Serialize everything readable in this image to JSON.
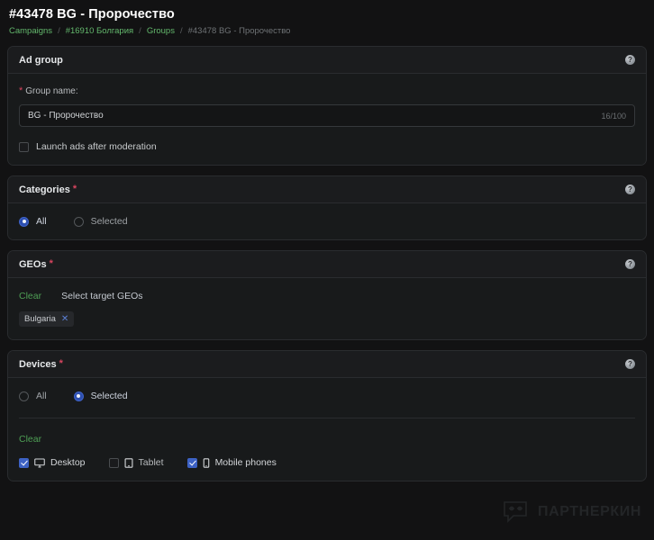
{
  "header": {
    "title": "#43478 BG - Пророчество",
    "breadcrumb": [
      {
        "label": "Campaigns",
        "type": "link"
      },
      {
        "label": "/",
        "type": "sep"
      },
      {
        "label": "#16910 Болгария",
        "type": "link"
      },
      {
        "label": "/",
        "type": "sep"
      },
      {
        "label": "Groups",
        "type": "link"
      },
      {
        "label": "/",
        "type": "sep"
      },
      {
        "label": "#43478 BG - Пророчество",
        "type": "current"
      }
    ]
  },
  "ad_group": {
    "card_title": "Ad group",
    "help_icon": "question-mark-icon",
    "field_label": "Group name:",
    "required_mark": "*",
    "input_value": "BG - Пророчество",
    "input_counter": "16/100",
    "checkbox_label": "Launch ads after moderation",
    "checkbox_checked": false
  },
  "categories": {
    "card_title": "Categories",
    "required_mark": "*",
    "help_icon": "question-mark-icon",
    "options": [
      {
        "label": "All",
        "selected": true
      },
      {
        "label": "Selected",
        "selected": false
      }
    ]
  },
  "geos": {
    "card_title": "GEOs",
    "required_mark": "*",
    "help_icon": "question-mark-icon",
    "clear_label": "Clear",
    "select_label": "Select target GEOs",
    "chips": [
      {
        "label": "Bulgaria",
        "close_icon": "close-icon"
      }
    ]
  },
  "devices": {
    "card_title": "Devices",
    "required_mark": "*",
    "help_icon": "question-mark-icon",
    "options": [
      {
        "label": "All",
        "selected": false
      },
      {
        "label": "Selected",
        "selected": true
      }
    ],
    "clear_label": "Clear",
    "items": [
      {
        "label": "Desktop",
        "icon": "desktop-icon",
        "checked": true
      },
      {
        "label": "Tablet",
        "icon": "tablet-icon",
        "checked": false
      },
      {
        "label": "Mobile phones",
        "icon": "mobile-phone-icon",
        "checked": true
      }
    ]
  },
  "watermark": {
    "text": "ПАРТНЕРКИН",
    "logo_icon": "speech-bubble-logo-icon"
  },
  "colors": {
    "page_bg": "#121213",
    "card_bg": "#181a1b",
    "accent_blue": "#3d62c4",
    "accent_green": "#4e9f55",
    "required_red": "#d8455f"
  }
}
